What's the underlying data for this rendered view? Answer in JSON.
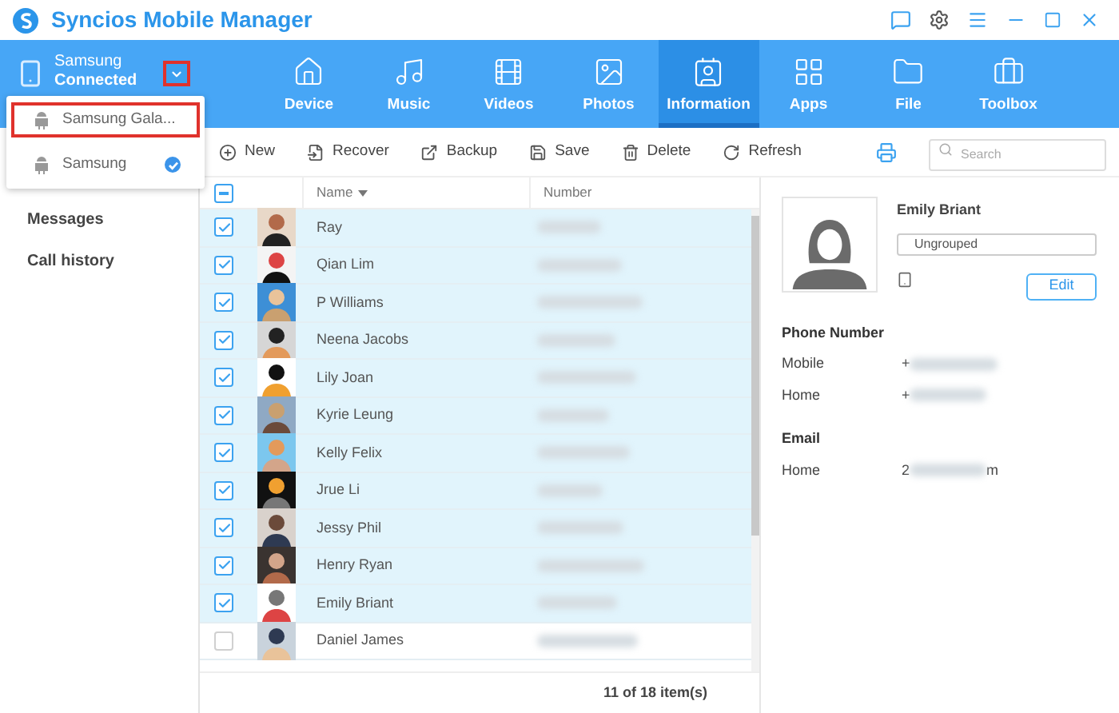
{
  "window": {
    "title": "Syncios Mobile Manager"
  },
  "device": {
    "name": "Samsung",
    "status": "Connected"
  },
  "device_menu": {
    "open": true,
    "items": [
      {
        "label": "Samsung Gala...",
        "selected": false,
        "highlighted": true
      },
      {
        "label": "Samsung",
        "selected": true,
        "highlighted": false
      }
    ]
  },
  "nav_tabs": [
    {
      "label": "Device",
      "kind": "device",
      "selected": false
    },
    {
      "label": "Music",
      "kind": "music",
      "selected": false
    },
    {
      "label": "Videos",
      "kind": "videos",
      "selected": false
    },
    {
      "label": "Photos",
      "kind": "photos",
      "selected": false
    },
    {
      "label": "Information",
      "kind": "information",
      "selected": true
    },
    {
      "label": "Apps",
      "kind": "apps",
      "selected": false
    },
    {
      "label": "File",
      "kind": "file",
      "selected": false
    },
    {
      "label": "Toolbox",
      "kind": "toolbox",
      "selected": false
    }
  ],
  "sidebar": {
    "items": [
      {
        "label": "Messages",
        "selected": false
      },
      {
        "label": "Call history",
        "selected": false
      }
    ]
  },
  "toolbar": {
    "buttons": [
      {
        "label": "New",
        "kind": "new"
      },
      {
        "label": "Recover",
        "kind": "recover"
      },
      {
        "label": "Backup",
        "kind": "backup"
      },
      {
        "label": "Save",
        "kind": "save"
      },
      {
        "label": "Delete",
        "kind": "delete"
      },
      {
        "label": "Refresh",
        "kind": "refresh"
      }
    ],
    "search": {
      "placeholder": "Search"
    }
  },
  "table": {
    "select_all": {
      "partial": true
    },
    "columns": [
      {
        "label": "Name",
        "sorted": true
      },
      {
        "label": "Number",
        "sorted": false
      }
    ],
    "rows": [
      {
        "name": "Ray",
        "checked": true
      },
      {
        "name": "Qian Lim",
        "checked": true
      },
      {
        "name": "P Williams",
        "checked": true
      },
      {
        "name": "Neena Jacobs",
        "checked": true
      },
      {
        "name": "Lily Joan",
        "checked": true
      },
      {
        "name": "Kyrie Leung",
        "checked": true
      },
      {
        "name": "Kelly Felix",
        "checked": true
      },
      {
        "name": "Jrue Li",
        "checked": true
      },
      {
        "name": "Jessy Phil",
        "checked": true
      },
      {
        "name": "Henry Ryan",
        "checked": true
      },
      {
        "name": "Emily Briant",
        "checked": true
      },
      {
        "name": "Daniel James",
        "checked": false
      }
    ]
  },
  "status_bar": {
    "text": "11 of 18 item(s)"
  },
  "detail": {
    "name": "Emily Briant",
    "group": "Ungrouped",
    "edit_button": "Edit",
    "sections": [
      {
        "title": "Phone Number",
        "fields": [
          {
            "label": "Mobile",
            "start": "+"
          },
          {
            "label": "Home",
            "start": "+"
          }
        ]
      },
      {
        "title": "Email",
        "fields": [
          {
            "label": "Home",
            "start": "2",
            "end": "m"
          }
        ]
      }
    ]
  }
}
